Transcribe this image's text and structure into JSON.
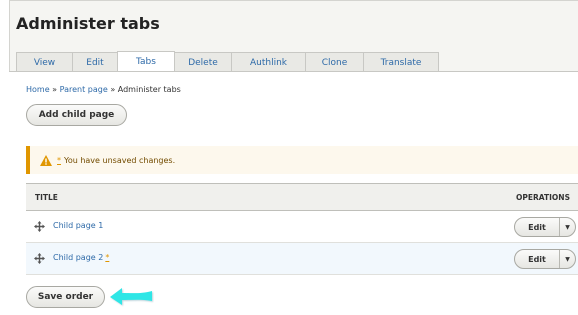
{
  "page": {
    "title": "Administer tabs"
  },
  "tabs": [
    {
      "label": "View"
    },
    {
      "label": "Edit"
    },
    {
      "label": "Tabs",
      "active": true
    },
    {
      "label": "Delete"
    },
    {
      "label": "Authlink"
    },
    {
      "label": "Clone"
    },
    {
      "label": "Translate"
    }
  ],
  "breadcrumb": {
    "home": "Home",
    "sep": "»",
    "parent": "Parent page",
    "current": "Administer tabs"
  },
  "actions": {
    "add_child": "Add child page",
    "save_order": "Save order"
  },
  "message": {
    "asterisk": "*",
    "text": "You have unsaved changes."
  },
  "table": {
    "headers": {
      "title": "TITLE",
      "operations": "OPERATIONS"
    },
    "rows": [
      {
        "title": "Child page 1",
        "changed_marker": "",
        "op_label": "Edit",
        "op_toggle": "▼"
      },
      {
        "title": "Child page 2",
        "changed_marker": "*",
        "op_label": "Edit",
        "op_toggle": "▼"
      }
    ]
  },
  "colors": {
    "accent_link": "#2e6aa8",
    "warning": "#e09600",
    "arrow": "#2ee6e6"
  },
  "icons": {
    "warning": "warning-icon",
    "drag": "drag-handle-icon",
    "dropdown": "chevron-down-icon",
    "arrow": "pointer-arrow-icon"
  }
}
